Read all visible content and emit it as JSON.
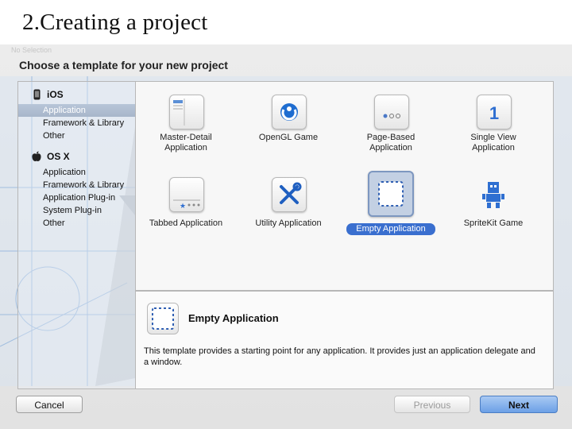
{
  "slide": {
    "title": "2.Creating a project"
  },
  "sheet": {
    "faint_title": "No Selection",
    "header": "Choose a template for your new project"
  },
  "sidebar": {
    "ios_label": "iOS",
    "ios_items": [
      "Application",
      "Framework & Library",
      "Other"
    ],
    "osx_label": "OS X",
    "osx_items": [
      "Application",
      "Framework & Library",
      "Application Plug-in",
      "System Plug-in",
      "Other"
    ],
    "selected": "iOS / Application"
  },
  "templates": [
    {
      "label_line1": "Master-Detail",
      "label_line2": "Application",
      "icon": "master-detail-icon"
    },
    {
      "label_line1": "OpenGL Game",
      "label_line2": "",
      "icon": "opengl-game-icon"
    },
    {
      "label_line1": "Page-Based",
      "label_line2": "Application",
      "icon": "page-based-icon"
    },
    {
      "label_line1": "Single View",
      "label_line2": "Application",
      "icon": "single-view-icon"
    },
    {
      "label_line1": "Tabbed Application",
      "label_line2": "",
      "icon": "tabbed-icon"
    },
    {
      "label_line1": "Utility Application",
      "label_line2": "",
      "icon": "utility-icon"
    },
    {
      "label_line1": "Empty Application",
      "label_line2": "",
      "icon": "empty-application-icon",
      "selected": true
    },
    {
      "label_line1": "SpriteKit Game",
      "label_line2": "",
      "icon": "spritekit-icon"
    }
  ],
  "detail": {
    "title": "Empty Application",
    "description": "This template provides a starting point for any application. It provides just an application delegate and a window."
  },
  "buttons": {
    "cancel": "Cancel",
    "previous": "Previous",
    "next": "Next"
  },
  "colors": {
    "selection_blue": "#3a6fcf",
    "next_button": "#6ca0e6",
    "blueprint": "#8fb3dc"
  }
}
